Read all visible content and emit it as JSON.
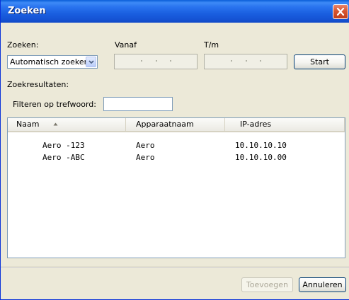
{
  "window": {
    "title": "Zoeken"
  },
  "search": {
    "mode_label": "Zoeken:",
    "mode_value": "Automatisch zoeken",
    "from_label": "Vanaf",
    "to_label": "T/m",
    "start_label": "Start"
  },
  "results": {
    "label": "Zoekresultaten:",
    "filter_label": "Filteren op trefwoord:",
    "filter_value": "",
    "columns": [
      "Naam",
      "Apparaatnaam",
      "IP-adres"
    ],
    "sort_column": "Naam",
    "sort_direction": "ascending",
    "rows": [
      {
        "name": "Aero -123",
        "device": "Aero",
        "ip": "10.10.10.10"
      },
      {
        "name": "Aero -ABC",
        "device": "Aero",
        "ip": "10.10.10.00"
      }
    ]
  },
  "footer": {
    "add_label": "Toevoegen",
    "add_enabled": false,
    "cancel_label": "Annuleren"
  },
  "colors": {
    "titlebar": "#2a74ef",
    "window_bg": "#ece9d8",
    "close_button": "#d8552f",
    "field_border": "#7f9db9"
  },
  "icons": {
    "close": "close-icon",
    "dropdown": "chevron-down-icon",
    "sort": "sort-ascending-icon"
  }
}
